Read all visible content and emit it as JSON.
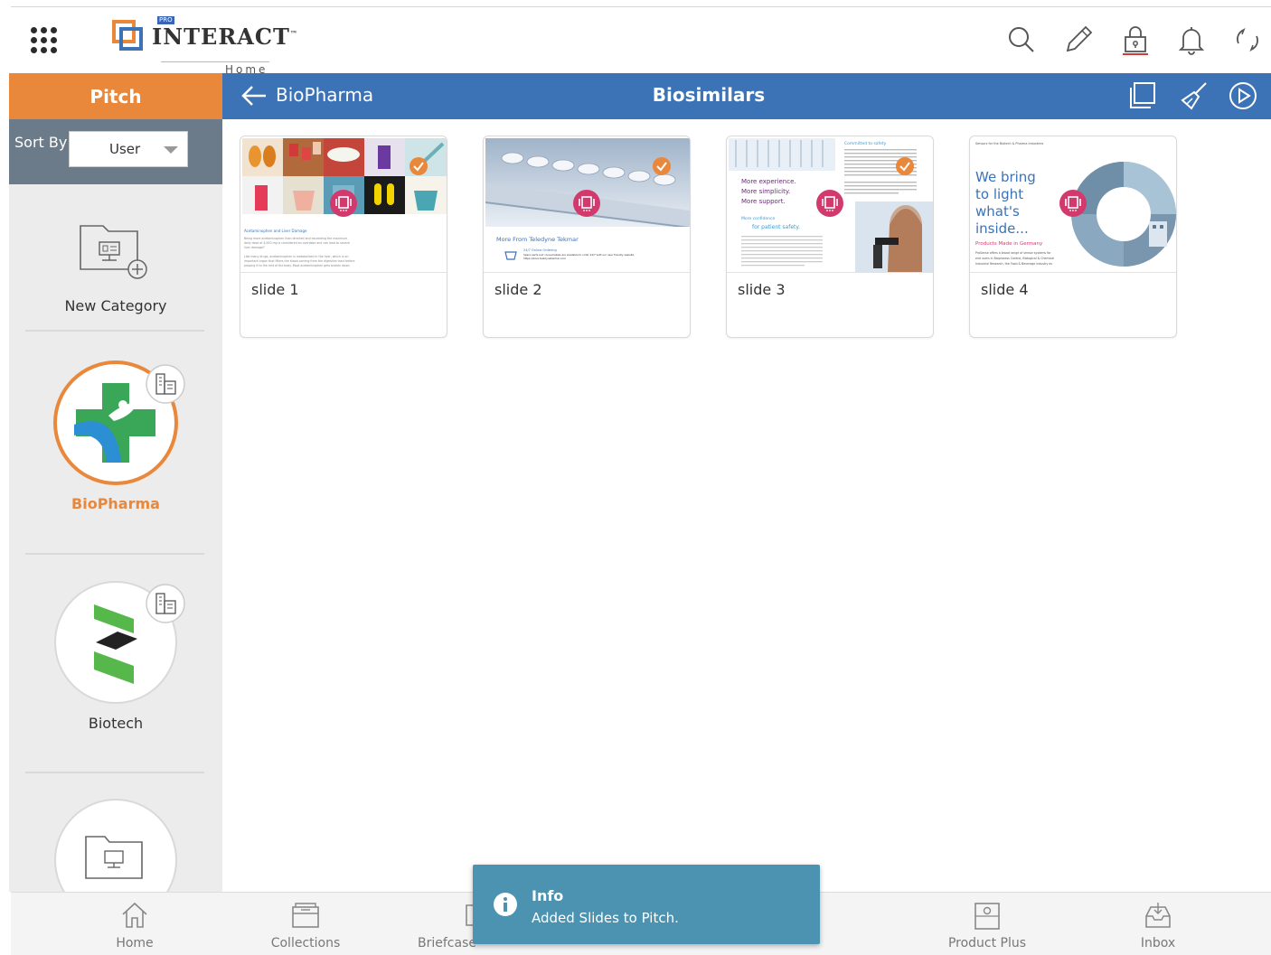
{
  "header": {
    "logo_badge": "PRO",
    "logo_name": "INTERACT",
    "logo_tm": "™",
    "subtitle": "Home",
    "icons": [
      "search-icon",
      "pencil-icon",
      "lock-icon",
      "bell-icon",
      "sync-icon"
    ]
  },
  "pitch_tab": {
    "label": "Pitch"
  },
  "breadcrumb": {
    "back": "BioPharma"
  },
  "page_title": "Biosimilars",
  "toolbar_icons": [
    "copy-icon",
    "broom-icon",
    "play-circle-icon"
  ],
  "sidebar": {
    "sort_label": "Sort By",
    "sort_value": "User",
    "items": [
      {
        "label": "New Category",
        "active": false
      },
      {
        "label": "BioPharma",
        "active": true
      },
      {
        "label": "Biotech",
        "active": false
      },
      {
        "label": "",
        "active": false
      }
    ]
  },
  "slides": [
    {
      "label": "slide 1",
      "checked": true,
      "thumb": {
        "heading": "Acetaminophen and Liver Damage",
        "body": [
          "Being more acetaminophen than directed and exceeding the maximum",
          "daily dose of 4,000 mg is considered an overdose and can lead to severe",
          "liver damage?",
          "Like many drugs, acetaminophen is metabolized in the liver, which is an",
          "important organ that filters the blood coming from the digestive tract before",
          "passing it to the rest of the body. Most acetaminophen gets broken down"
        ]
      }
    },
    {
      "label": "slide 2",
      "checked": true,
      "thumb": {
        "heading": "More From Teledyne Tekmar",
        "ordering": "24/7 Online Ordering",
        "ordering_detail": "Spare parts and consumables are available to order 24/7 with our user friendly website",
        "url": "https://store.teledynetekmar.com"
      }
    },
    {
      "label": "slide 3",
      "checked": true,
      "thumb": {
        "tag": "Committed to safety",
        "lines": [
          "More experience.",
          "More simplicity.",
          "More support."
        ],
        "sub": "More confidence",
        "sub2": "for patient safety."
      }
    },
    {
      "label": "slide 4",
      "checked": false,
      "thumb": {
        "top": "Sensors for the Biotech & Pharma Industries",
        "lines": [
          "We bring",
          "to light",
          "what's",
          "inside..."
        ],
        "made": "Products Made in Germany",
        "body": [
          "ProSense offers a broad range of sensor systems for",
          "end users in Bioprocess Control, Biological & Chemical",
          "Industrial Research, the Food & Beverage Industry as"
        ]
      }
    }
  ],
  "bottom_nav": [
    {
      "label": "Home",
      "icon": "home-icon"
    },
    {
      "label": "Collections",
      "icon": "collections-icon"
    },
    {
      "label": "Briefcase",
      "icon": "briefcase-icon"
    },
    {
      "label": "Product Plus",
      "icon": "product-plus-icon"
    },
    {
      "label": "Inbox",
      "icon": "inbox-icon"
    }
  ],
  "toast": {
    "title": "Info",
    "message": "Added Slides to Pitch."
  },
  "colors": {
    "orange": "#e9873b",
    "blue": "#3c72b6",
    "slate": "#6b7b8a",
    "toast": "#4b93b0",
    "magenta": "#d23a6e"
  }
}
